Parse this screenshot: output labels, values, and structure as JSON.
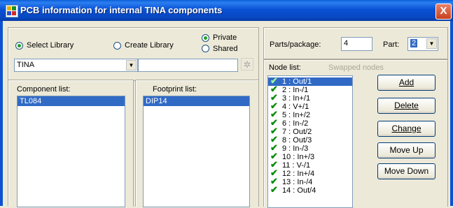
{
  "window": {
    "title": "PCB information for internal TINA components",
    "close": "X"
  },
  "library": {
    "select_label": "Select Library",
    "create_label": "Create Library",
    "private_label": "Private",
    "shared_label": "Shared",
    "library_value": "TINA",
    "library_search_value": ""
  },
  "component_list": {
    "label": "Component list:",
    "items": [
      "TL084"
    ]
  },
  "footprint_list": {
    "label": "Footprint list:",
    "items": [
      "DIP14"
    ]
  },
  "parts": {
    "package_label": "Parts/package:",
    "package_value": "4",
    "part_label": "Part:",
    "part_value": "2"
  },
  "nodes": {
    "label": "Node list:",
    "swapped_label": "Swapped nodes",
    "check_glyph": "✔",
    "items": [
      "1 : Out/1",
      "2 : In-/1",
      "3 : In+/1",
      "4 : V+/1",
      "5 : In+/2",
      "6 : In-/2",
      "7 : Out/2",
      "8 : Out/3",
      "9 : In-/3",
      "10 : In+/3",
      "11 : V-/1",
      "12 : In+/4",
      "13 : In-/4",
      "14 : Out/4"
    ]
  },
  "buttons": {
    "add": "Add",
    "delete": "Delete",
    "change": "Change",
    "move_up": "Move Up",
    "move_down": "Move Down"
  }
}
